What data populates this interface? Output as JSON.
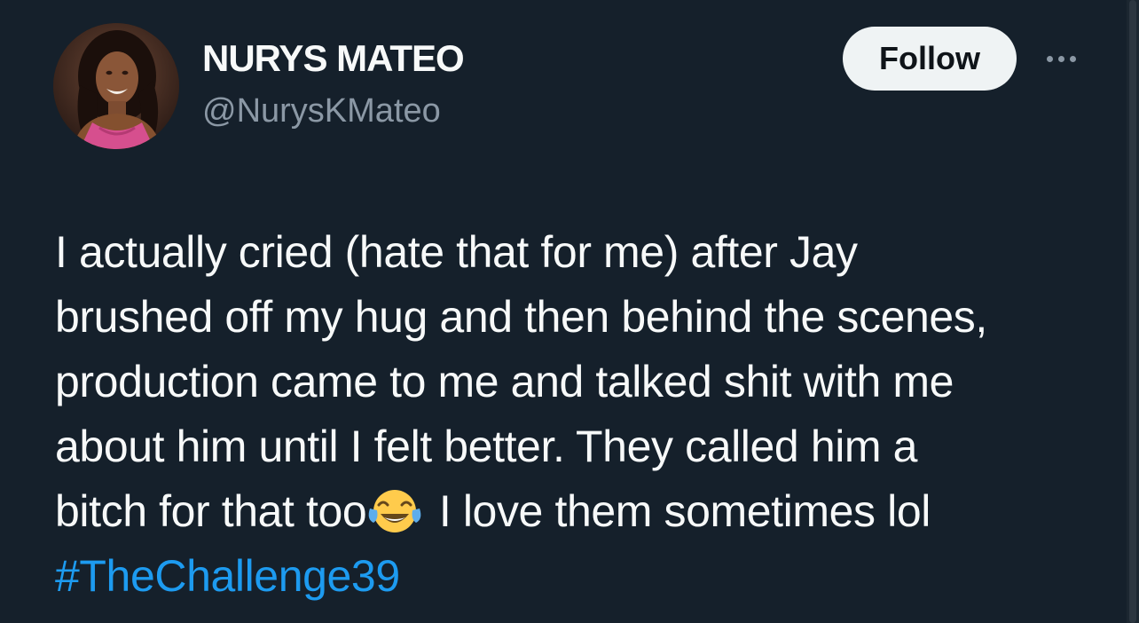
{
  "author": {
    "display_name": "NURYS MATEO",
    "handle": "@NurysKMateo",
    "avatar_icon": "profile-photo"
  },
  "actions": {
    "follow_label": "Follow",
    "more_icon": "ellipsis-icon"
  },
  "tweet": {
    "lines": [
      "I actually cried (hate that for me) after Jay",
      "brushed off my hug and then behind the scenes,",
      "production came to me and talked shit with me",
      "about him until I felt better. They called him a"
    ],
    "line5_before_emoji": "bitch for that too",
    "emoji": "face-with-tears-of-joy",
    "line5_after_emoji": " I love them sometimes lol",
    "hashtag": "#TheChallenge39"
  },
  "colors": {
    "background": "#15202b",
    "text": "#f7f9f9",
    "secondary_text": "#8b98a5",
    "link": "#1d9bf0",
    "follow_button_bg": "#eff3f4"
  }
}
